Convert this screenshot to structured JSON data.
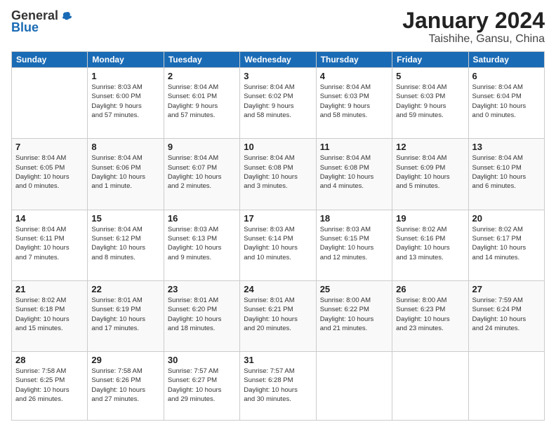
{
  "header": {
    "logo_general": "General",
    "logo_blue": "Blue",
    "title": "January 2024",
    "location": "Taishihe, Gansu, China"
  },
  "columns": [
    "Sunday",
    "Monday",
    "Tuesday",
    "Wednesday",
    "Thursday",
    "Friday",
    "Saturday"
  ],
  "weeks": [
    {
      "row_class": "odd-row",
      "days": [
        {
          "num": "",
          "info": ""
        },
        {
          "num": "1",
          "info": "Sunrise: 8:03 AM\nSunset: 6:00 PM\nDaylight: 9 hours\nand 57 minutes."
        },
        {
          "num": "2",
          "info": "Sunrise: 8:04 AM\nSunset: 6:01 PM\nDaylight: 9 hours\nand 57 minutes."
        },
        {
          "num": "3",
          "info": "Sunrise: 8:04 AM\nSunset: 6:02 PM\nDaylight: 9 hours\nand 58 minutes."
        },
        {
          "num": "4",
          "info": "Sunrise: 8:04 AM\nSunset: 6:03 PM\nDaylight: 9 hours\nand 58 minutes."
        },
        {
          "num": "5",
          "info": "Sunrise: 8:04 AM\nSunset: 6:03 PM\nDaylight: 9 hours\nand 59 minutes."
        },
        {
          "num": "6",
          "info": "Sunrise: 8:04 AM\nSunset: 6:04 PM\nDaylight: 10 hours\nand 0 minutes."
        }
      ]
    },
    {
      "row_class": "even-row",
      "days": [
        {
          "num": "7",
          "info": "Sunrise: 8:04 AM\nSunset: 6:05 PM\nDaylight: 10 hours\nand 0 minutes."
        },
        {
          "num": "8",
          "info": "Sunrise: 8:04 AM\nSunset: 6:06 PM\nDaylight: 10 hours\nand 1 minute."
        },
        {
          "num": "9",
          "info": "Sunrise: 8:04 AM\nSunset: 6:07 PM\nDaylight: 10 hours\nand 2 minutes."
        },
        {
          "num": "10",
          "info": "Sunrise: 8:04 AM\nSunset: 6:08 PM\nDaylight: 10 hours\nand 3 minutes."
        },
        {
          "num": "11",
          "info": "Sunrise: 8:04 AM\nSunset: 6:08 PM\nDaylight: 10 hours\nand 4 minutes."
        },
        {
          "num": "12",
          "info": "Sunrise: 8:04 AM\nSunset: 6:09 PM\nDaylight: 10 hours\nand 5 minutes."
        },
        {
          "num": "13",
          "info": "Sunrise: 8:04 AM\nSunset: 6:10 PM\nDaylight: 10 hours\nand 6 minutes."
        }
      ]
    },
    {
      "row_class": "odd-row",
      "days": [
        {
          "num": "14",
          "info": "Sunrise: 8:04 AM\nSunset: 6:11 PM\nDaylight: 10 hours\nand 7 minutes."
        },
        {
          "num": "15",
          "info": "Sunrise: 8:04 AM\nSunset: 6:12 PM\nDaylight: 10 hours\nand 8 minutes."
        },
        {
          "num": "16",
          "info": "Sunrise: 8:03 AM\nSunset: 6:13 PM\nDaylight: 10 hours\nand 9 minutes."
        },
        {
          "num": "17",
          "info": "Sunrise: 8:03 AM\nSunset: 6:14 PM\nDaylight: 10 hours\nand 10 minutes."
        },
        {
          "num": "18",
          "info": "Sunrise: 8:03 AM\nSunset: 6:15 PM\nDaylight: 10 hours\nand 12 minutes."
        },
        {
          "num": "19",
          "info": "Sunrise: 8:02 AM\nSunset: 6:16 PM\nDaylight: 10 hours\nand 13 minutes."
        },
        {
          "num": "20",
          "info": "Sunrise: 8:02 AM\nSunset: 6:17 PM\nDaylight: 10 hours\nand 14 minutes."
        }
      ]
    },
    {
      "row_class": "even-row",
      "days": [
        {
          "num": "21",
          "info": "Sunrise: 8:02 AM\nSunset: 6:18 PM\nDaylight: 10 hours\nand 15 minutes."
        },
        {
          "num": "22",
          "info": "Sunrise: 8:01 AM\nSunset: 6:19 PM\nDaylight: 10 hours\nand 17 minutes."
        },
        {
          "num": "23",
          "info": "Sunrise: 8:01 AM\nSunset: 6:20 PM\nDaylight: 10 hours\nand 18 minutes."
        },
        {
          "num": "24",
          "info": "Sunrise: 8:01 AM\nSunset: 6:21 PM\nDaylight: 10 hours\nand 20 minutes."
        },
        {
          "num": "25",
          "info": "Sunrise: 8:00 AM\nSunset: 6:22 PM\nDaylight: 10 hours\nand 21 minutes."
        },
        {
          "num": "26",
          "info": "Sunrise: 8:00 AM\nSunset: 6:23 PM\nDaylight: 10 hours\nand 23 minutes."
        },
        {
          "num": "27",
          "info": "Sunrise: 7:59 AM\nSunset: 6:24 PM\nDaylight: 10 hours\nand 24 minutes."
        }
      ]
    },
    {
      "row_class": "odd-row last-row",
      "days": [
        {
          "num": "28",
          "info": "Sunrise: 7:58 AM\nSunset: 6:25 PM\nDaylight: 10 hours\nand 26 minutes."
        },
        {
          "num": "29",
          "info": "Sunrise: 7:58 AM\nSunset: 6:26 PM\nDaylight: 10 hours\nand 27 minutes."
        },
        {
          "num": "30",
          "info": "Sunrise: 7:57 AM\nSunset: 6:27 PM\nDaylight: 10 hours\nand 29 minutes."
        },
        {
          "num": "31",
          "info": "Sunrise: 7:57 AM\nSunset: 6:28 PM\nDaylight: 10 hours\nand 30 minutes."
        },
        {
          "num": "",
          "info": ""
        },
        {
          "num": "",
          "info": ""
        },
        {
          "num": "",
          "info": ""
        }
      ]
    }
  ]
}
